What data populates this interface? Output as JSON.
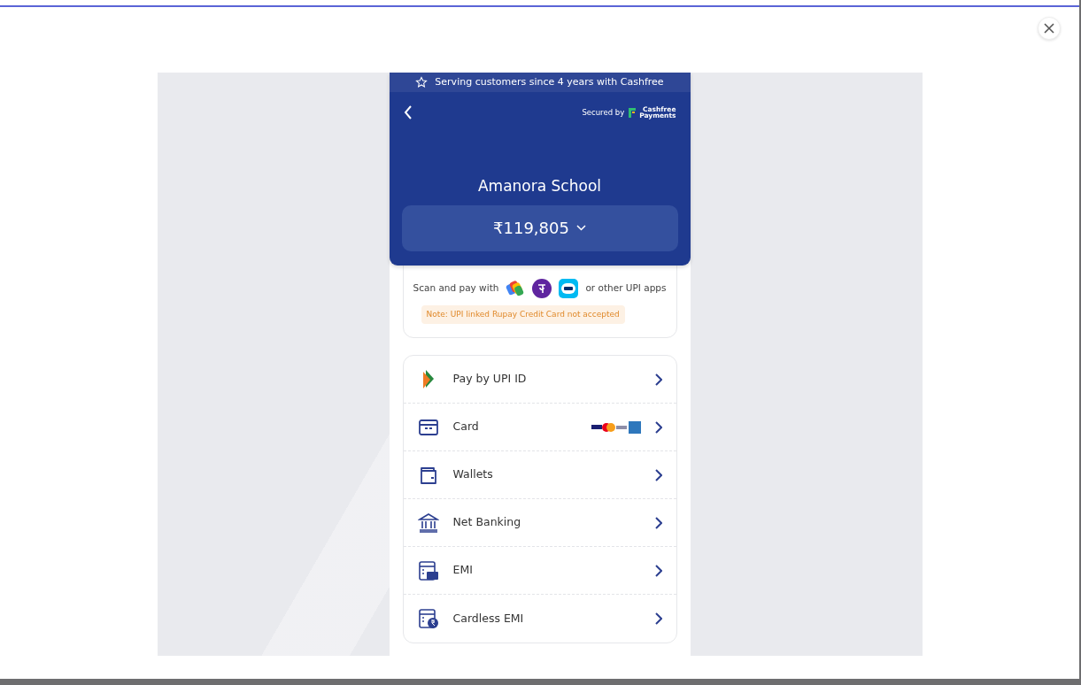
{
  "banner": {
    "text": "Serving customers since 4 years with Cashfree"
  },
  "header": {
    "secured_by": "Secured by",
    "brand_line1": "Cashfree",
    "brand_line2": "Payments",
    "merchant": "Amanora School",
    "amount": "₹119,805"
  },
  "upi": {
    "scan_text": "Scan and pay with",
    "other_text": "or other UPI apps",
    "note": "Note: UPI linked Rupay Credit Card not accepted"
  },
  "methods": [
    {
      "kind": "upi",
      "label": "Pay by UPI ID",
      "card_logos": false
    },
    {
      "kind": "card",
      "label": "Card",
      "card_logos": true
    },
    {
      "kind": "wallet",
      "label": "Wallets",
      "card_logos": false
    },
    {
      "kind": "bank",
      "label": "Net Banking",
      "card_logos": false
    },
    {
      "kind": "emi",
      "label": "EMI",
      "card_logos": false
    },
    {
      "kind": "cardless",
      "label": "Cardless EMI",
      "card_logos": false
    }
  ]
}
